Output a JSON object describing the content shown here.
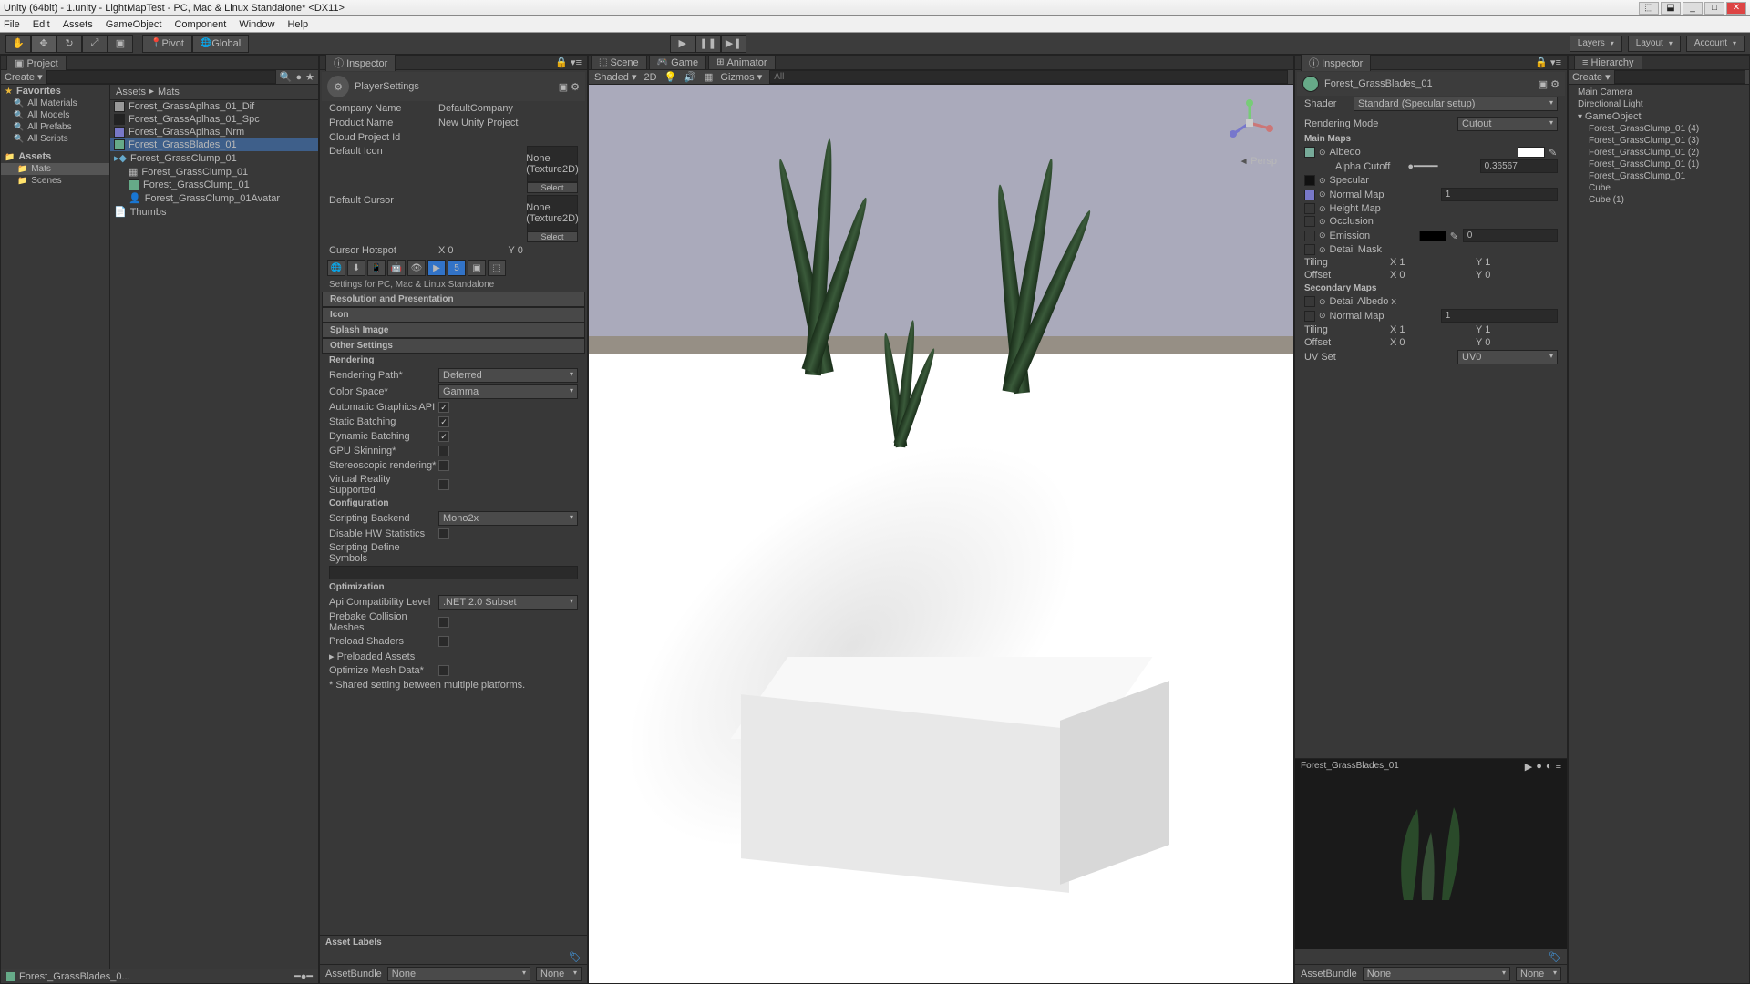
{
  "window": {
    "title": "Unity (64bit) - 1.unity - LightMapTest - PC, Mac & Linux Standalone* <DX11>"
  },
  "menubar": [
    "File",
    "Edit",
    "Assets",
    "GameObject",
    "Component",
    "Window",
    "Help"
  ],
  "toolbar": {
    "pivot": "Pivot",
    "global": "Global",
    "layers": "Layers",
    "layout": "Layout",
    "account": "Account"
  },
  "project": {
    "tab": "Project",
    "create": "Create",
    "favorites": "Favorites",
    "favItems": [
      "All Materials",
      "All Models",
      "All Prefabs",
      "All Scripts"
    ],
    "assets": "Assets",
    "assetFolders": [
      "Mats",
      "Scenes"
    ],
    "breadcrumb": [
      "Assets",
      "Mats"
    ],
    "files": [
      {
        "name": "Forest_GrassAplhas_01_Dif",
        "type": "tex"
      },
      {
        "name": "Forest_GrassAplhas_01_Spc",
        "type": "tex"
      },
      {
        "name": "Forest_GrassAplhas_Nrm",
        "type": "tex"
      },
      {
        "name": "Forest_GrassBlades_01",
        "type": "mat",
        "selected": true
      },
      {
        "name": "Forest_GrassClump_01",
        "type": "prefab"
      },
      {
        "name": "Forest_GrassClump_01",
        "type": "mesh"
      },
      {
        "name": "Forest_GrassClump_01",
        "type": "mat"
      },
      {
        "name": "Forest_GrassClump_01Avatar",
        "type": "avatar"
      },
      {
        "name": "Thumbs",
        "type": "file"
      }
    ],
    "footer": "Forest_GrassBlades_0..."
  },
  "inspector1": {
    "tab": "Inspector",
    "title": "PlayerSettings",
    "companyNameLabel": "Company Name",
    "companyName": "DefaultCompany",
    "productNameLabel": "Product Name",
    "productName": "New Unity Project",
    "cloudProjectIdLabel": "Cloud Project Id",
    "defaultIconLabel": "Default Icon",
    "noneTex": "None\n(Texture2D)",
    "select": "Select",
    "defaultCursorLabel": "Default Cursor",
    "cursorHotspotLabel": "Cursor Hotspot",
    "cursorX": "X 0",
    "cursorY": "Y 0",
    "settingsFor": "Settings for PC, Mac & Linux Standalone",
    "sections": {
      "resPres": "Resolution and Presentation",
      "icon": "Icon",
      "splash": "Splash Image",
      "other": "Other Settings"
    },
    "rendering": "Rendering",
    "renderingPathLabel": "Rendering Path*",
    "renderingPath": "Deferred",
    "colorSpaceLabel": "Color Space*",
    "colorSpace": "Gamma",
    "autoGraphicsLabel": "Automatic Graphics API",
    "staticBatchLabel": "Static Batching",
    "dynBatchLabel": "Dynamic Batching",
    "gpuSkinLabel": "GPU Skinning*",
    "stereoLabel": "Stereoscopic rendering*",
    "vrLabel": "Virtual Reality Supported",
    "configuration": "Configuration",
    "scriptingBackendLabel": "Scripting Backend",
    "scriptingBackend": "Mono2x",
    "disableHWLabel": "Disable HW Statistics",
    "definesLabel": "Scripting Define Symbols",
    "optimization": "Optimization",
    "apiCompatLabel": "Api Compatibility Level",
    "apiCompat": ".NET 2.0 Subset",
    "prebakeLabel": "Prebake Collision Meshes",
    "preloadShadersLabel": "Preload Shaders",
    "preloadedAssetsLabel": "Preloaded Assets",
    "optimizeMeshLabel": "Optimize Mesh Data*",
    "sharedNote": "* Shared setting between multiple platforms.",
    "assetLabels": "Asset Labels",
    "assetBundle": "AssetBundle",
    "none": "None"
  },
  "scene": {
    "tabs": [
      "Scene",
      "Game",
      "Animator"
    ],
    "shaded": "Shaded",
    "twoD": "2D",
    "gizmos": "Gizmos",
    "allSearch": "All",
    "persp": "Persp"
  },
  "inspector2": {
    "tab": "Inspector",
    "matName": "Forest_GrassBlades_01",
    "shaderLabel": "Shader",
    "shader": "Standard (Specular setup)",
    "renderModeLabel": "Rendering Mode",
    "renderMode": "Cutout",
    "mainMaps": "Main Maps",
    "albedo": "Albedo",
    "alphaCutoffLabel": "Alpha Cutoff",
    "alphaCutoff": "0.36567",
    "specular": "Specular",
    "normalMap": "Normal Map",
    "normalVal": "1",
    "heightMap": "Height Map",
    "occlusion": "Occlusion",
    "emission": "Emission",
    "emissionVal": "0",
    "detailMask": "Detail Mask",
    "tiling": "Tiling",
    "offset": "Offset",
    "tileX": "X 1",
    "tileY": "Y 1",
    "offX": "X 0",
    "offY": "Y 0",
    "secondaryMaps": "Secondary Maps",
    "detailAlbedo": "Detail Albedo x",
    "uvSet": "UV Set",
    "uvSetVal": "UV0",
    "previewTitle": "Forest_GrassBlades_01",
    "assetBundle": "AssetBundle",
    "none": "None"
  },
  "hierarchy": {
    "tab": "Hierarchy",
    "create": "Create",
    "items": [
      "Main Camera",
      "Directional Light",
      "GameObject",
      "  Forest_GrassClump_01 (4)",
      "  Forest_GrassClump_01 (3)",
      "  Forest_GrassClump_01 (2)",
      "  Forest_GrassClump_01 (1)",
      "  Forest_GrassClump_01",
      "  Cube",
      "  Cube (1)"
    ]
  }
}
